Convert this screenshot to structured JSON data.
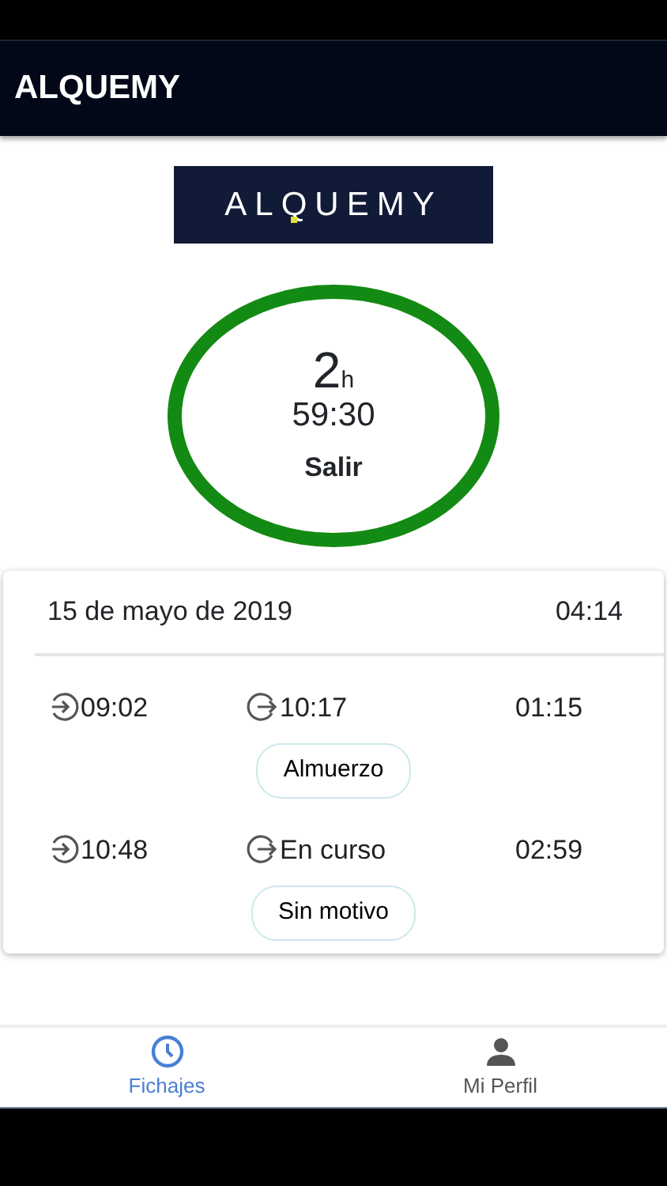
{
  "app_bar": {
    "title": "ALQUEMY"
  },
  "logo": {
    "text": "ALQUEMY"
  },
  "timer": {
    "hours": "2",
    "hours_unit": "h",
    "time": "59:30",
    "action": "Salir"
  },
  "day": {
    "date": "15 de mayo de 2019",
    "total": "04:14",
    "entries": [
      {
        "in": "09:02",
        "out": "10:17",
        "duration": "01:15",
        "reason": "Almuerzo"
      },
      {
        "in": "10:48",
        "out": "En curso",
        "duration": "02:59",
        "reason": "Sin motivo"
      }
    ]
  },
  "bottom_nav": [
    {
      "label": "Fichajes",
      "kind": "clock",
      "selected": true
    },
    {
      "label": "Mi Perfil",
      "kind": "person",
      "selected": false
    }
  ]
}
